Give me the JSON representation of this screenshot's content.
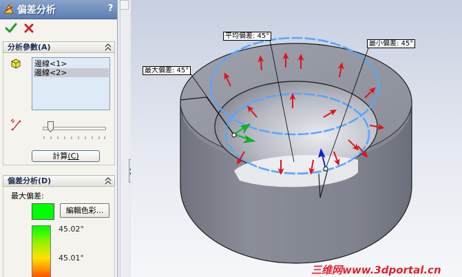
{
  "window": {
    "title": "偏差分析",
    "help": "?"
  },
  "params_group": {
    "title": "分析參數(A)",
    "edges": [
      "邊線<1>",
      "邊線<2>"
    ],
    "calculate_label": "計算",
    "calculate_shortcut": "(C)"
  },
  "deviation_group": {
    "title": "偏差分析(D)",
    "max_deviation_label": "最大偏差:",
    "swatch_color": "#00ff00",
    "edit_color_label": "編輯色彩...",
    "legend_labels": [
      "45.02°",
      "45.01°"
    ]
  },
  "viewport": {
    "callouts": {
      "average": "平均偏差: 45°",
      "minimum": "最小偏差: 45°",
      "maximum": "最大偏差: 45°"
    },
    "watermark": "三维网www.3dportal.cn"
  },
  "colors": {
    "arrow": "#e0121b",
    "arrow_max": "#00c21c",
    "arrow_min": "#1020d0",
    "edge_highlight": "#5aa6ff"
  }
}
